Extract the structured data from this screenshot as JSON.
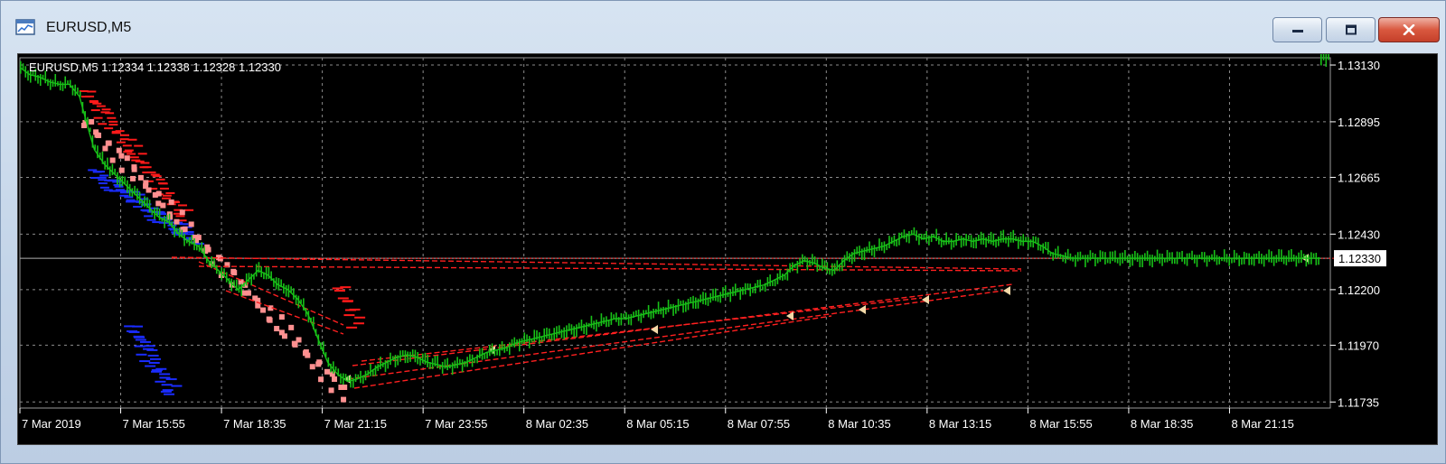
{
  "window": {
    "title": "EURUSD,M5",
    "icons": {
      "app": "chart-window-icon",
      "minimize": "minimize-icon",
      "maximize": "restore-icon",
      "close": "close-icon"
    }
  },
  "chart": {
    "header": "EURUSD,M5  1.12334 1.12338 1.12328 1.12330",
    "current_price_label": "1.12330",
    "colors": {
      "background": "#000000",
      "grid": "#8c8c8c",
      "axis_text": "#ffffff",
      "candles": "#18c018",
      "sell_trades": "#ff1a1a",
      "buy_trades": "#1a2cff",
      "price_line": "#b0b0b0",
      "price_label_bg": "#ffffff",
      "order_line": "#ff2020"
    }
  },
  "chart_data": {
    "type": "line",
    "ylim": [
      1.1171,
      1.1316
    ],
    "y_ticks": [
      "1.13130",
      "1.12895",
      "1.12665",
      "1.12430",
      "1.12200",
      "1.11970",
      "1.11735"
    ],
    "x_ticks": [
      "7 Mar 2019",
      "7 Mar 15:55",
      "7 Mar 18:35",
      "7 Mar 21:15",
      "7 Mar 23:55",
      "8 Mar 02:35",
      "8 Mar 05:15",
      "8 Mar 07:55",
      "8 Mar 10:35",
      "8 Mar 13:15",
      "8 Mar 15:55",
      "8 Mar 18:35",
      "8 Mar 21:15"
    ],
    "current_price": 1.1233,
    "x": [
      0,
      4,
      8,
      12,
      16,
      20,
      24,
      28,
      30,
      32,
      34,
      36,
      40,
      44,
      48,
      52,
      56,
      60,
      64,
      68,
      72,
      76,
      80,
      84,
      88,
      92,
      96,
      100,
      104,
      108,
      112,
      116,
      120,
      124,
      128,
      132,
      136,
      140,
      144,
      148,
      152,
      156,
      160,
      164,
      168,
      172,
      176,
      180,
      184,
      188,
      192,
      196,
      200,
      204,
      208,
      212,
      216,
      220,
      224,
      228,
      232,
      236,
      240,
      244,
      248,
      252,
      256,
      260,
      264,
      268,
      272,
      276,
      280,
      284,
      288,
      292,
      296,
      300,
      304,
      308,
      312,
      316,
      320,
      324,
      328,
      332,
      336,
      340,
      344,
      348,
      352,
      356,
      360,
      364,
      368,
      372,
      376,
      380,
      384,
      388,
      392,
      396,
      400,
      404,
      408,
      412,
      416,
      420,
      424,
      428,
      432,
      436,
      440,
      444,
      448,
      452,
      456,
      460,
      464,
      468,
      472,
      476,
      480,
      484,
      488,
      492,
      496,
      500,
      504,
      508,
      512,
      516,
      520,
      524,
      528
    ],
    "series": [
      {
        "values": [
          1.1312,
          1.1309,
          1.1308,
          1.1306,
          1.1305,
          1.1305,
          1.13,
          1.1285,
          1.1278,
          1.1275,
          1.1272,
          1.127,
          1.1266,
          1.1262,
          1.1258,
          1.1254,
          1.125,
          1.1248,
          1.1243,
          1.124,
          1.1238,
          1.1232,
          1.1228,
          1.1224,
          1.122,
          1.1224,
          1.1228,
          1.1226,
          1.1222,
          1.122,
          1.1216,
          1.121,
          1.12,
          1.119,
          1.1185,
          1.1182,
          1.1183,
          1.1185,
          1.1188,
          1.119,
          1.1192,
          1.1193,
          1.1192,
          1.119,
          1.1189,
          1.1188,
          1.1189,
          1.119,
          1.1192,
          1.1194,
          1.1195,
          1.1196,
          1.1198,
          1.1199,
          1.12,
          1.1201,
          1.1202,
          1.1203,
          1.1204,
          1.1205,
          1.1206,
          1.1207,
          1.1208,
          1.1208,
          1.1209,
          1.121,
          1.1211,
          1.1212,
          1.1213,
          1.1214,
          1.1215,
          1.1216,
          1.1217,
          1.1218,
          1.1219,
          1.122,
          1.1221,
          1.1222,
          1.1224,
          1.1226,
          1.123,
          1.1232,
          1.1231,
          1.1229,
          1.1228,
          1.1232,
          1.1235,
          1.1236,
          1.1237,
          1.1238,
          1.124,
          1.1242,
          1.1243,
          1.1241,
          1.1242,
          1.124,
          1.124,
          1.1241,
          1.124,
          1.1241,
          1.124,
          1.1241,
          1.1241,
          1.124,
          1.124,
          1.1238,
          1.1235,
          1.1234,
          1.1233,
          1.1233,
          1.1233,
          1.1233,
          1.1233,
          1.1233,
          1.1233,
          1.1233,
          1.1233,
          1.1233,
          1.1233,
          1.1233,
          1.1233,
          1.1233,
          1.1233,
          1.1233,
          1.1233,
          1.1233,
          1.1233,
          1.1233,
          1.1233,
          1.1233,
          1.1233,
          1.1233,
          1.1233,
          1.1233
        ]
      }
    ]
  }
}
